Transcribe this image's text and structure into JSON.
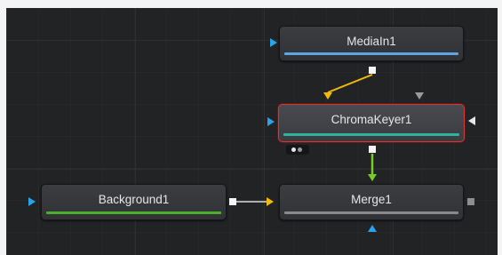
{
  "nodes": {
    "mediain": {
      "label": "MediaIn1",
      "bar_color": "#5aa7e6"
    },
    "chromakeyer": {
      "label": "ChromaKeyer1",
      "bar_color": "#2bb59a",
      "selected": true
    },
    "background": {
      "label": "Background1",
      "bar_color": "#4caf2a"
    },
    "merge": {
      "label": "Merge1",
      "bar_color": "#8a8a8a"
    }
  },
  "connections": [
    {
      "from": "MediaIn1",
      "to": "ChromaKeyer1",
      "color": "#f0b90b"
    },
    {
      "from": "ChromaKeyer1",
      "to": "Merge1",
      "color": "#7acb2a"
    },
    {
      "from": "Background1",
      "to": "Merge1",
      "color": "#dddddd"
    }
  ],
  "colors": {
    "canvas": "#222325",
    "selection_border": "#d23a3a",
    "input_blue": "#2aa3e8",
    "input_yellow": "#f0b90b"
  }
}
